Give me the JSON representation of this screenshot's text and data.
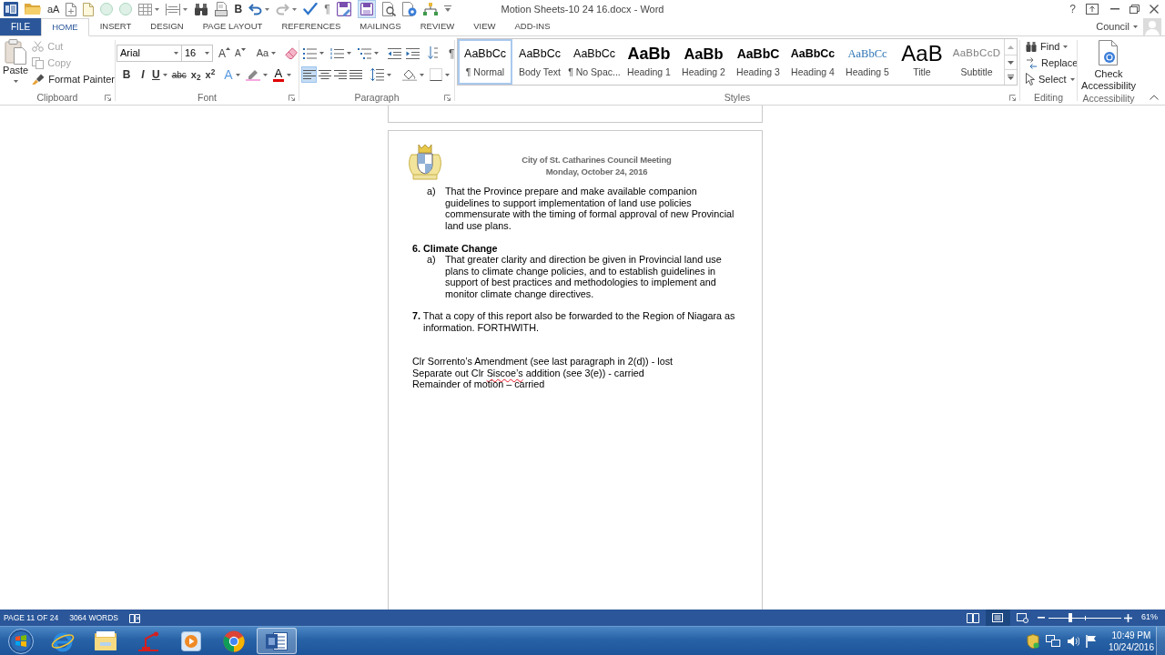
{
  "window": {
    "title": "Motion Sheets-10 24 16.docx - Word",
    "help": "?",
    "user": "Council"
  },
  "quick_access_toolbar": {
    "case_glyph": "aA",
    "bold_glyph": "B",
    "pilcrow_glyph": "¶"
  },
  "ribbon_tabs": [
    {
      "label": "FILE",
      "kind": "file",
      "selected": false
    },
    {
      "label": "HOME",
      "kind": "tab",
      "selected": true
    },
    {
      "label": "INSERT",
      "kind": "tab",
      "selected": false
    },
    {
      "label": "DESIGN",
      "kind": "tab",
      "selected": false
    },
    {
      "label": "PAGE LAYOUT",
      "kind": "tab",
      "selected": false
    },
    {
      "label": "REFERENCES",
      "kind": "tab",
      "selected": false
    },
    {
      "label": "MAILINGS",
      "kind": "tab",
      "selected": false
    },
    {
      "label": "REVIEW",
      "kind": "tab",
      "selected": false
    },
    {
      "label": "VIEW",
      "kind": "tab",
      "selected": false
    },
    {
      "label": "ADD-INS",
      "kind": "tab",
      "selected": false
    }
  ],
  "ribbon": {
    "clipboard": {
      "label": "Clipboard",
      "paste": "Paste",
      "cut": {
        "label": "Cut",
        "disabled": true
      },
      "copy": {
        "label": "Copy",
        "disabled": true
      },
      "format_painter": {
        "label": "Format Painter",
        "disabled": false
      }
    },
    "font": {
      "label": "Font",
      "font_name": "Arial",
      "font_size": "16",
      "grow": "A",
      "shrink": "A",
      "change_case": "Aa",
      "bold": "B",
      "italic": "I",
      "underline": "U",
      "strikethrough": "abc",
      "subscript": "x$_{2}$",
      "superscript": "x$^{2}$",
      "text_effects": "A",
      "font_color": "A"
    },
    "paragraph": {
      "label": "Paragraph",
      "show_marks": "¶",
      "alignment": [
        {
          "selected": true
        },
        {
          "selected": false
        },
        {
          "selected": false
        },
        {
          "selected": false
        }
      ]
    },
    "styles": {
      "label": "Styles",
      "items": [
        {
          "preview": "AaBbCc",
          "name": "¶ Normal",
          "kind": "plain",
          "selected": true
        },
        {
          "preview": "AaBbCc",
          "name": "Body Text",
          "kind": "plain",
          "selected": false
        },
        {
          "preview": "AaBbCc",
          "name": "¶ No Spac...",
          "kind": "plain",
          "selected": false
        },
        {
          "preview": "AaBb",
          "name": "Heading 1",
          "kind": "heading1",
          "selected": false
        },
        {
          "preview": "AaBb",
          "name": "Heading 2",
          "kind": "heading2",
          "selected": false
        },
        {
          "preview": "AaBbC",
          "name": "Heading 3",
          "kind": "heading3",
          "selected": false
        },
        {
          "preview": "AaBbCc",
          "name": "Heading 4",
          "kind": "heading4",
          "selected": false
        },
        {
          "preview": "AaBbCc",
          "name": "Heading 5",
          "kind": "heading5",
          "selected": false
        },
        {
          "preview": "AaB",
          "name": "Title",
          "kind": "title",
          "selected": false
        },
        {
          "preview": "AaBbCcD",
          "name": "Subtitle",
          "kind": "subtitle",
          "selected": false
        }
      ]
    },
    "editing": {
      "label": "Editing",
      "find": "Find",
      "replace": "Replace",
      "select": "Select"
    },
    "accessibility": {
      "label": "Accessibility",
      "check": "Check Accessibility"
    }
  },
  "document": {
    "header": {
      "title": "City of St. Catharines Council Meeting",
      "date": "Monday, October 24, 2016"
    },
    "blocks": [
      {
        "kind": "subitem",
        "marker": "a)",
        "text": "That the Province prepare and make available companion guidelines to support implementation of land use policies commensurate with the timing of formal approval of new Provincial land use plans."
      },
      {
        "kind": "heading",
        "text": "6. Climate Change"
      },
      {
        "kind": "subitem",
        "marker": "a)",
        "text": "That greater clarity and direction be given in Provincial land use plans to climate change policies, and to establish guidelines in support of best practices and methodologies to implement and monitor climate change directives."
      },
      {
        "kind": "item",
        "marker": "7.",
        "text": "That a copy of this report also be forwarded to the Region of Niagara as information. FORTHWITH."
      },
      {
        "kind": "line",
        "segments": [
          {
            "text": "Clr Sorrento’s Amendment (see last paragraph in 2(d)) - lost",
            "misspelled": false
          }
        ]
      },
      {
        "kind": "line",
        "segments": [
          {
            "text": "Separate out Clr ",
            "misspelled": false
          },
          {
            "text": "Siscoe’s",
            "misspelled": true
          },
          {
            "text": " addition (see 3(e)) - carried",
            "misspelled": false
          }
        ]
      },
      {
        "kind": "line",
        "segments": [
          {
            "text": "Remainder of motion – carried",
            "misspelled": false
          }
        ]
      }
    ]
  },
  "status_bar": {
    "page": "PAGE 11 OF 24",
    "words": "3064 WORDS",
    "views": [
      {
        "selected": false
      },
      {
        "selected": true
      },
      {
        "selected": false
      }
    ],
    "zoom": {
      "level": 0.3,
      "reading": "61%"
    }
  },
  "taskbar": {
    "apps": [
      {
        "selected": false
      },
      {
        "selected": false
      },
      {
        "selected": false
      },
      {
        "selected": false
      },
      {
        "selected": false
      },
      {
        "selected": true
      }
    ],
    "clock": {
      "time": "10:49 PM",
      "date": "10/24/2016"
    }
  }
}
